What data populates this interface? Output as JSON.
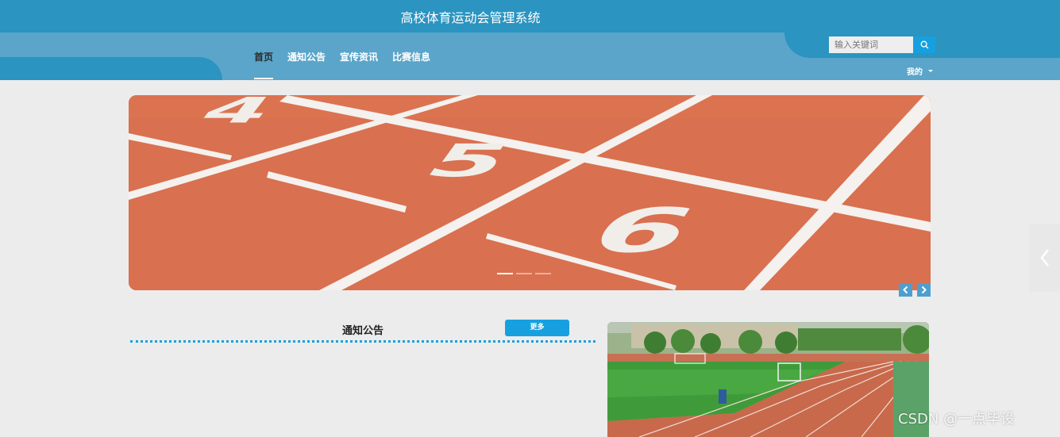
{
  "header": {
    "title": "高校体育运动会管理系统",
    "nav": [
      {
        "label": "首页",
        "active": true
      },
      {
        "label": "通知公告",
        "active": false
      },
      {
        "label": "宣传资讯",
        "active": false
      },
      {
        "label": "比赛信息",
        "active": false
      }
    ],
    "search": {
      "placeholder": "输入关键词",
      "icon": "search-icon"
    },
    "user_menu": {
      "label": "我的",
      "icon": "chevron-down-icon"
    }
  },
  "banner": {
    "lane_numbers": [
      "4",
      "5",
      "6"
    ],
    "slide_count": 3,
    "active_slide": 1
  },
  "notice": {
    "title": "通知公告",
    "more_label": "更多"
  },
  "watermark": "CSDN @一点毕设",
  "colors": {
    "header_dark": "#2b94c0",
    "header_light": "#5aa5c9",
    "accent": "#17a0e0",
    "track": "#d9704f",
    "page_bg": "#ececec"
  }
}
